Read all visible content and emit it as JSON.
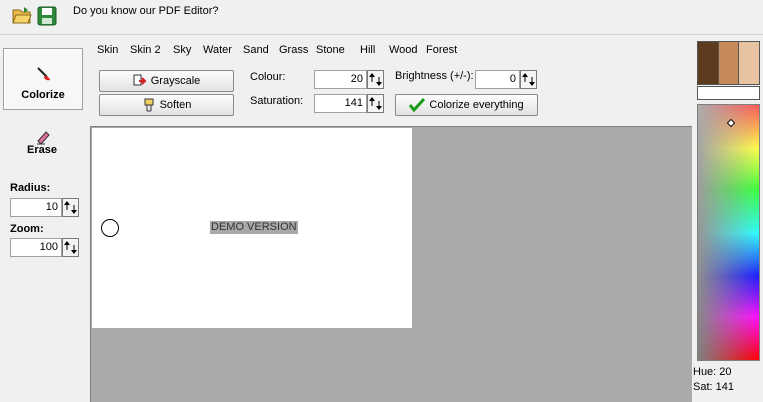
{
  "top": {
    "message": "Do you know our PDF Editor?",
    "icons": [
      "open-folder-icon",
      "save-icon"
    ]
  },
  "left": {
    "colorize_label": "Colorize",
    "erase_label": "Erase",
    "radius_label": "Radius:",
    "radius_value": "10",
    "zoom_label": "Zoom:",
    "zoom_value": "100"
  },
  "categories": [
    "Skin",
    "Skin 2",
    "Sky",
    "Water",
    "Sand",
    "Grass",
    "Stone",
    "Hill",
    "Wood",
    "Forest"
  ],
  "controls": {
    "grayscale_label": "Grayscale",
    "soften_label": "Soften",
    "colour_label": "Colour:",
    "colour_value": "20",
    "saturation_label": "Saturation:",
    "saturation_value": "141",
    "brightness_label": "Brightness (+/-):",
    "brightness_value": "0",
    "colorize_all_label": "Colorize everything"
  },
  "canvas": {
    "watermark": "DEMO VERSION"
  },
  "right": {
    "swatch_colors": [
      "#5c3b1e",
      "#c58a5a",
      "#e8c3a1"
    ],
    "selected_color": "#ffffff",
    "hue_text": "Hue: 20",
    "sat_text": "Sat: 141"
  }
}
